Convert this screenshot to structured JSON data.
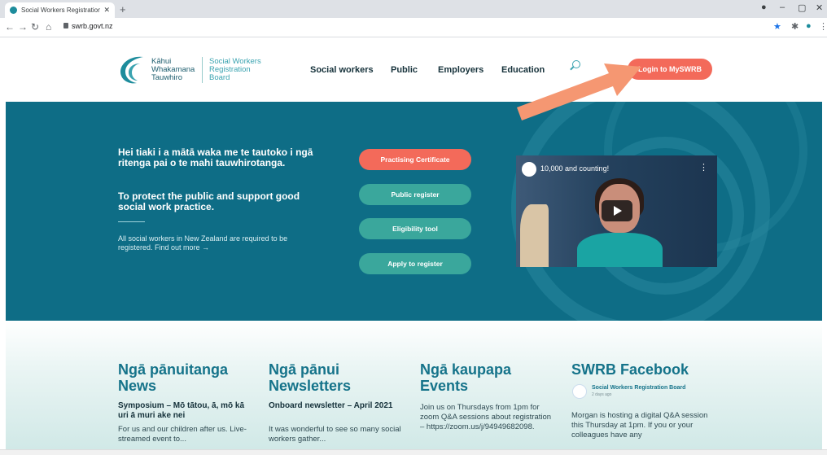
{
  "browser": {
    "tab_title": "Social Workers Registration Boar",
    "url": "swrb.govt.nz"
  },
  "header": {
    "logo_maori": [
      "Kāhui",
      "Whakamana",
      "Tauwhiro"
    ],
    "logo_en": [
      "Social Workers",
      "Registration",
      "Board"
    ],
    "nav": [
      "Social workers",
      "Public",
      "Employers",
      "Education"
    ],
    "login_label": "Login to MySWRB"
  },
  "hero": {
    "maori_heading": "Hei tiaki i a mātā waka me te tautoko i ngā ritenga pai o te mahi tauwhirotanga.",
    "english_heading": "To protect the public and support good social work practice.",
    "body": "All social workers in New Zealand are required to be registered. Find out more →",
    "buttons": [
      "Practising Certificate",
      "Public register",
      "Eligibility tool",
      "Apply to register"
    ],
    "video_title": "10,000 and counting!"
  },
  "colors": {
    "hero_bg": "#0e6d86",
    "accent_coral": "#f36a5a",
    "pill_teal": "#3aa79c",
    "heading_teal": "#15738a"
  },
  "columns": [
    {
      "heading": [
        "Ngā pānuitanga",
        "News"
      ],
      "title": "Symposium – Mō tātou, ā, mō kā uri ā muri ake nei",
      "body": "For us and our children after us. Live-streamed event to..."
    },
    {
      "heading": [
        "Ngā pānui",
        "Newsletters"
      ],
      "title": "Onboard newsletter – April 2021",
      "body": "It was wonderful to see so many social workers gather..."
    },
    {
      "heading": [
        "Ngā kaupapa",
        "Events"
      ],
      "title": "",
      "body": "Join us on Thursdays from 1pm for zoom Q&A sessions about registration – https://zoom.us/j/94949682098."
    },
    {
      "heading": [
        "SWRB Facebook"
      ],
      "fb_name": "Social Workers Registration Board",
      "fb_time": "2 days ago",
      "body": "Morgan is hosting a digital Q&A session this Thursday at 1pm. If you or your colleagues have any"
    }
  ]
}
